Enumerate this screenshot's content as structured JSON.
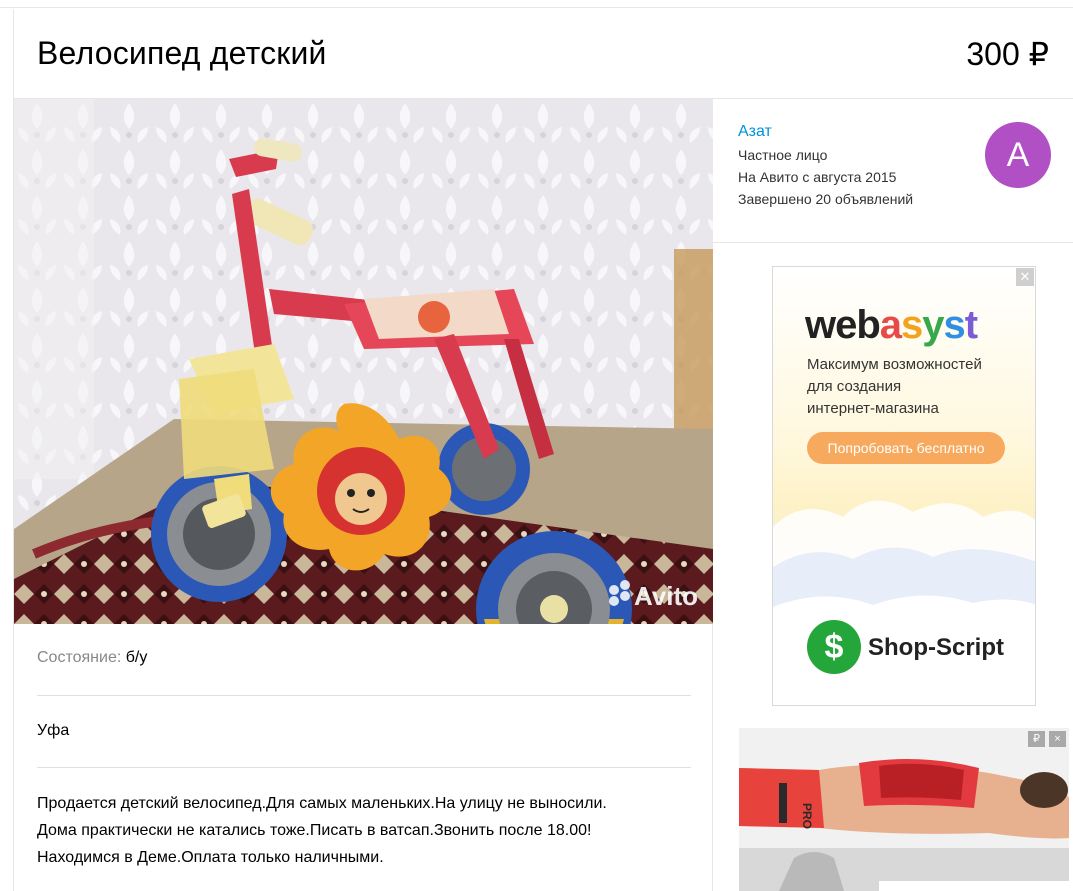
{
  "listing": {
    "title": "Велосипед детский",
    "price": "300 ₽",
    "photo_watermark": "Avito",
    "condition_label": "Состояние:",
    "condition_value": "б/у",
    "city": "Уфа",
    "description": [
      "Продается детский велосипед.Для самых маленьких.На улицу не выносили.",
      "Дома практически не катались тоже.Писать в ватсап.Звонить после 18.00!",
      "Находимся в Деме.Оплата только наличными."
    ]
  },
  "seller": {
    "name": "Азат",
    "type": "Частное лицо",
    "since": "На Авито с августа 2015",
    "completed": "Завершено 20 объявлений",
    "avatar_letter": "A",
    "avatar_color": "#b14fc5"
  },
  "ad_webasyst": {
    "logo_dark": "web",
    "logo_colored": "asyst",
    "tagline": [
      "Максимум возможностей",
      "для создания",
      "интернет-магазина"
    ],
    "cta": "Попробовать бесплатно",
    "brand_icon": "$",
    "brand": "Shop-Script",
    "close_icon": "close-icon"
  },
  "ad_fitness": {
    "badge_ruble": "₽",
    "badge_close": "×",
    "shorts_text": "PRO"
  },
  "colors": {
    "link": "#0091d9",
    "divider": "#e0e0e0",
    "cta": "#f7a95e",
    "shop_green": "#25a63b"
  }
}
